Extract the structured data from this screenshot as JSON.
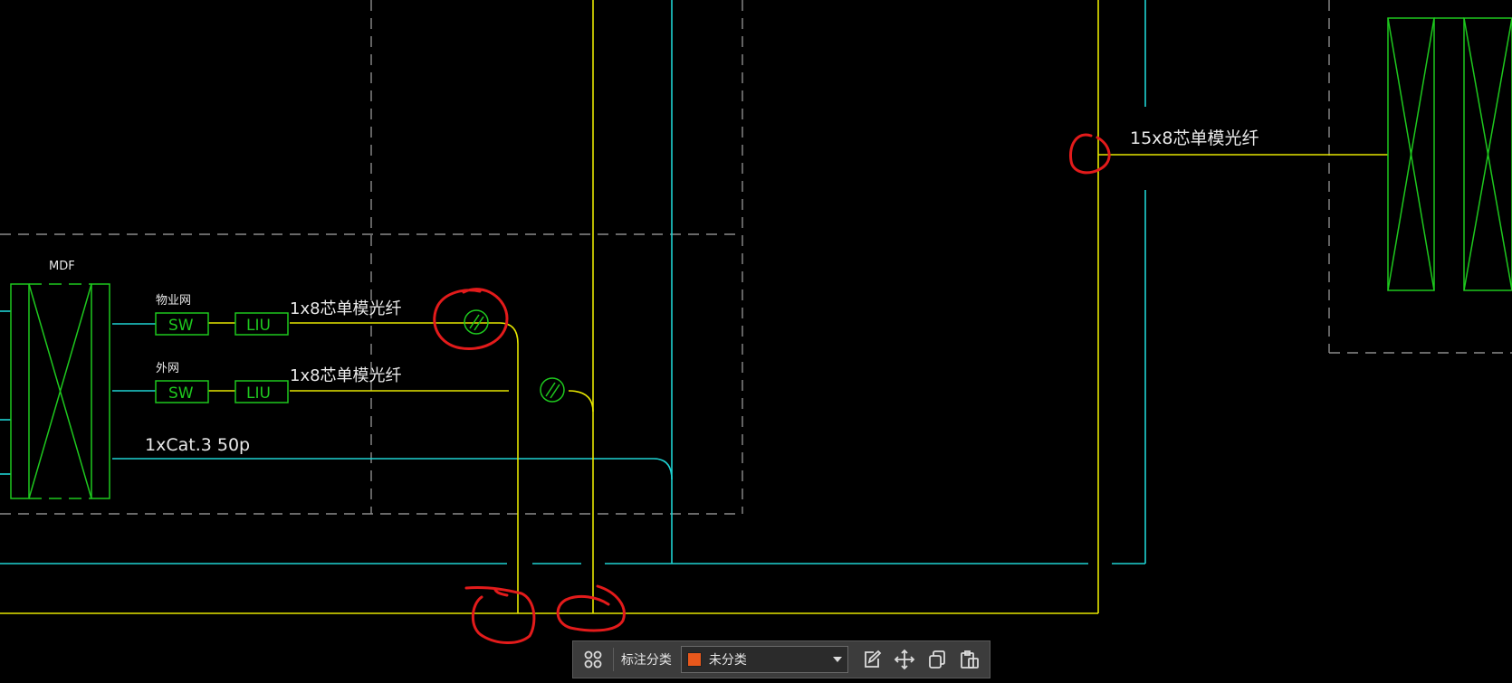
{
  "colors": {
    "background": "#000000",
    "cyan": "#1fd3d3",
    "yellow": "#e6e600",
    "green": "#1ec81e",
    "white": "#e8e8e8",
    "dashed": "#8c8c8c",
    "red_markup": "#e31b1b",
    "category_swatch": "#e8581c"
  },
  "drawing": {
    "mdf_label": "MDF",
    "net1_label": "物业网",
    "net2_label": "外网",
    "sw1": "SW",
    "liu1": "LIU",
    "sw2": "SW",
    "liu2": "LIU",
    "fiber1_label": "1x8芯单模光纤",
    "fiber2_label": "1x8芯单模光纤",
    "cat3_label": "1xCat.3 50p",
    "fiber_right_label": "15x8芯单模光纤"
  },
  "toolbar": {
    "grid_icon": "grid-icon",
    "category_label": "标注分类",
    "category_value": "未分类",
    "icons": [
      "edit-icon",
      "move-icon",
      "copy-icon",
      "paste-icon"
    ]
  }
}
